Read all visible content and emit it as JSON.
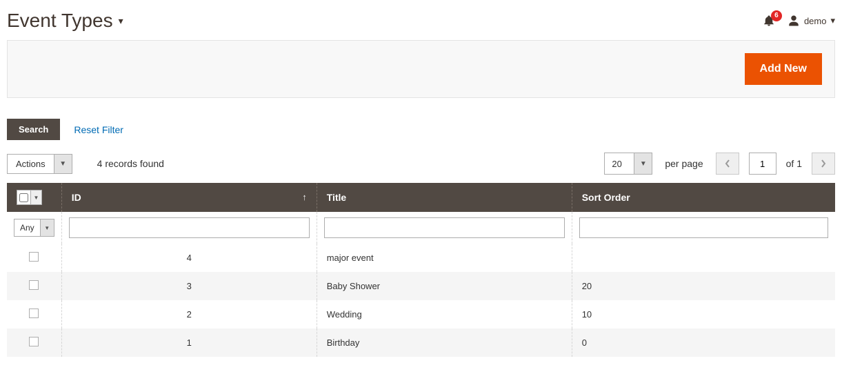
{
  "header": {
    "title": "Event Types",
    "notifications_count": "6",
    "username": "demo"
  },
  "toolbar": {
    "add_new_label": "Add New"
  },
  "gridControls": {
    "search_label": "Search",
    "reset_filter_label": "Reset Filter",
    "actions_label": "Actions",
    "records_count_text": "4 records found",
    "per_page_value": "20",
    "per_page_label": "per page",
    "current_page": "1",
    "total_pages_text": "of 1"
  },
  "columns": {
    "id_label": "ID",
    "title_label": "Title",
    "sort_order_label": "Sort Order"
  },
  "filters": {
    "any_label": "Any",
    "id_value": "",
    "title_value": "",
    "sort_order_value": ""
  },
  "rows": [
    {
      "id": "4",
      "title": "major event",
      "sort_order": ""
    },
    {
      "id": "3",
      "title": "Baby Shower",
      "sort_order": "20"
    },
    {
      "id": "2",
      "title": "Wedding",
      "sort_order": "10"
    },
    {
      "id": "1",
      "title": "Birthday",
      "sort_order": "0"
    }
  ],
  "colors": {
    "primary": "#eb5202",
    "dark": "#514943",
    "link": "#006bb4",
    "badge": "#e22626"
  }
}
